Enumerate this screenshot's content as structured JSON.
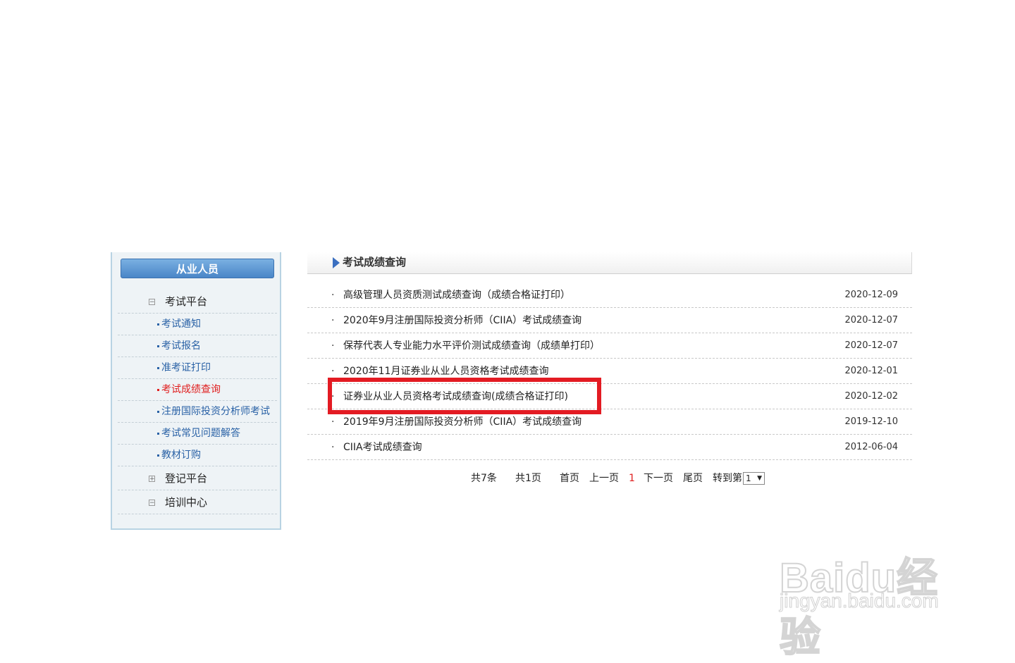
{
  "sidebar": {
    "header": "从业人员",
    "groups": [
      {
        "label": "考试平台",
        "toggle": "−"
      },
      {
        "label": "登记平台",
        "toggle": "+"
      },
      {
        "label": "培训中心",
        "toggle": "−"
      }
    ],
    "items": [
      {
        "label": "考试通知"
      },
      {
        "label": "考试报名"
      },
      {
        "label": "准考证打印"
      },
      {
        "label": "考试成绩查询",
        "active": true
      },
      {
        "label": "注册国际投资分析师考试"
      },
      {
        "label": "考试常见问题解答"
      },
      {
        "label": "教材订购"
      }
    ]
  },
  "main": {
    "title": "考试成绩查询",
    "bullet": "·",
    "results": [
      {
        "title": "高级管理人员资质测试成绩查询（成绩合格证打印）",
        "date": "2020-12-09"
      },
      {
        "title": "2020年9月注册国际投资分析师（CIIA）考试成绩查询",
        "date": "2020-12-07"
      },
      {
        "title": "保荐代表人专业能力水平评价测试成绩查询（成绩单打印）",
        "date": "2020-12-07"
      },
      {
        "title": "2020年11月证券业从业人员资格考试成绩查询",
        "date": "2020-12-01"
      },
      {
        "title": "证券业从业人员资格考试成绩查询(成绩合格证打印)",
        "date": "2020-12-02"
      },
      {
        "title": "2019年9月注册国际投资分析师（CIIA）考试成绩查询",
        "date": "2019-12-10"
      },
      {
        "title": "CIIA考试成绩查询",
        "date": "2012-06-04"
      }
    ]
  },
  "pagination": {
    "total_items": "共7条",
    "total_pages": "共1页",
    "first": "首页",
    "prev": "上一页",
    "current": "1",
    "next": "下一页",
    "last": "尾页",
    "goto_label": "转到第",
    "goto_value": "1",
    "caret": "▼"
  },
  "watermark": {
    "brand": "Baidu经验",
    "url": "jingyan.baidu.com"
  },
  "colors": {
    "highlight": "#e31b23",
    "active_link": "#e02020",
    "link": "#2a62a6",
    "sidebar_header": "#4a86c8"
  }
}
